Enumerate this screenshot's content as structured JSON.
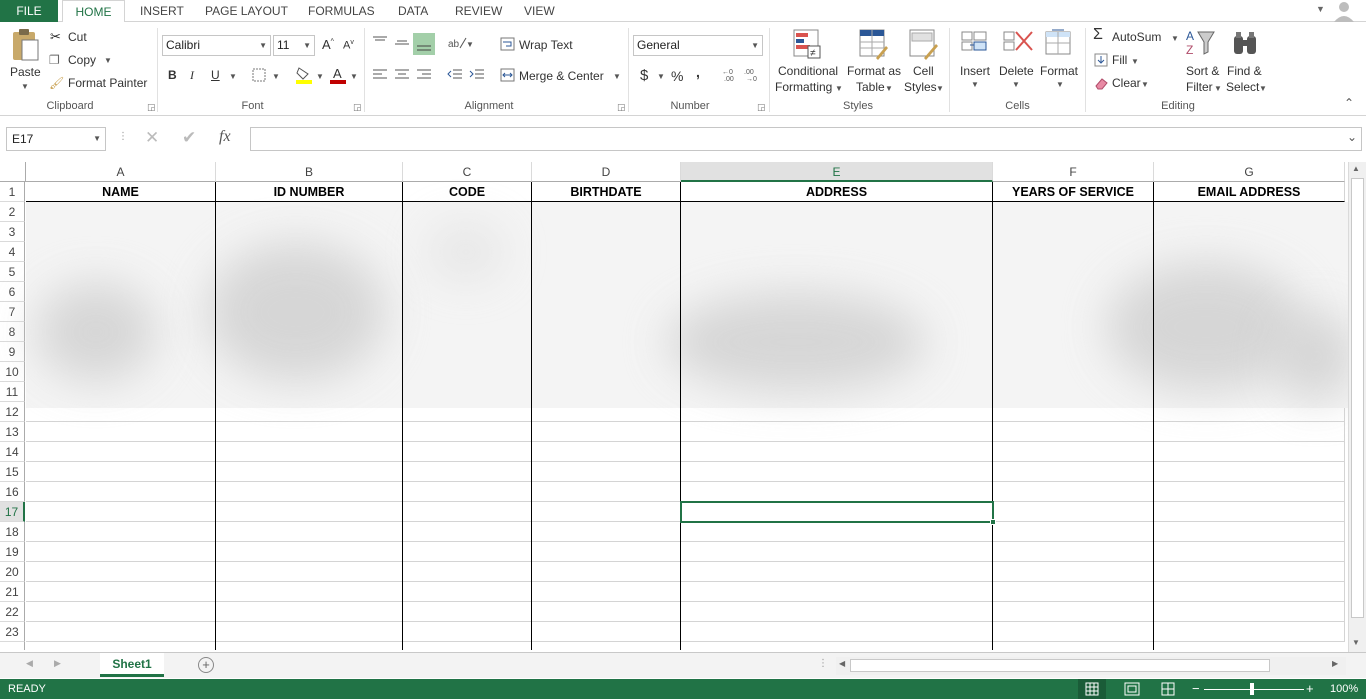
{
  "ribbon_tabs": [
    "FILE",
    "HOME",
    "INSERT",
    "PAGE LAYOUT",
    "FORMULAS",
    "DATA",
    "REVIEW",
    "VIEW"
  ],
  "clipboard": {
    "paste": "Paste",
    "cut": "Cut",
    "copy": "Copy",
    "format_painter": "Format Painter",
    "label": "Clipboard"
  },
  "font": {
    "name": "Calibri",
    "size": "11",
    "bold": "B",
    "italic": "I",
    "underline": "U",
    "label": "Font"
  },
  "alignment": {
    "wrap_text": "Wrap Text",
    "merge_center": "Merge & Center",
    "label": "Alignment"
  },
  "number": {
    "format": "General",
    "currency": "$",
    "percent": "%",
    "comma": ",",
    "label": "Number"
  },
  "styles": {
    "conditional_1": "Conditional",
    "conditional_2": "Formatting",
    "format_table_1": "Format as",
    "format_table_2": "Table",
    "cell_styles_1": "Cell",
    "cell_styles_2": "Styles",
    "label": "Styles"
  },
  "cells": {
    "insert": "Insert",
    "delete": "Delete",
    "format": "Format",
    "label": "Cells"
  },
  "editing": {
    "autosum": "AutoSum",
    "fill": "Fill",
    "clear": "Clear",
    "sort_1": "Sort &",
    "sort_2": "Filter",
    "find_1": "Find &",
    "find_2": "Select",
    "label": "Editing"
  },
  "formula_bar": {
    "name_box": "E17",
    "fx": "fx",
    "value": ""
  },
  "columns": [
    "A",
    "B",
    "C",
    "D",
    "E",
    "F",
    "G"
  ],
  "rows": [
    "1",
    "2",
    "3",
    "4",
    "5",
    "6",
    "7",
    "8",
    "9",
    "10",
    "11",
    "12",
    "13",
    "14",
    "15",
    "16",
    "17",
    "18",
    "19",
    "20",
    "21",
    "22",
    "23"
  ],
  "headers": [
    "NAME",
    "ID NUMBER",
    "CODE",
    "BIRTHDATE",
    "ADDRESS",
    "YEARS OF SERVICE",
    "EMAIL ADDRESS"
  ],
  "sheet": {
    "name": "Sheet1"
  },
  "status": {
    "text": "READY",
    "zoom": "100%"
  },
  "colors": {
    "accent": "#217346"
  }
}
